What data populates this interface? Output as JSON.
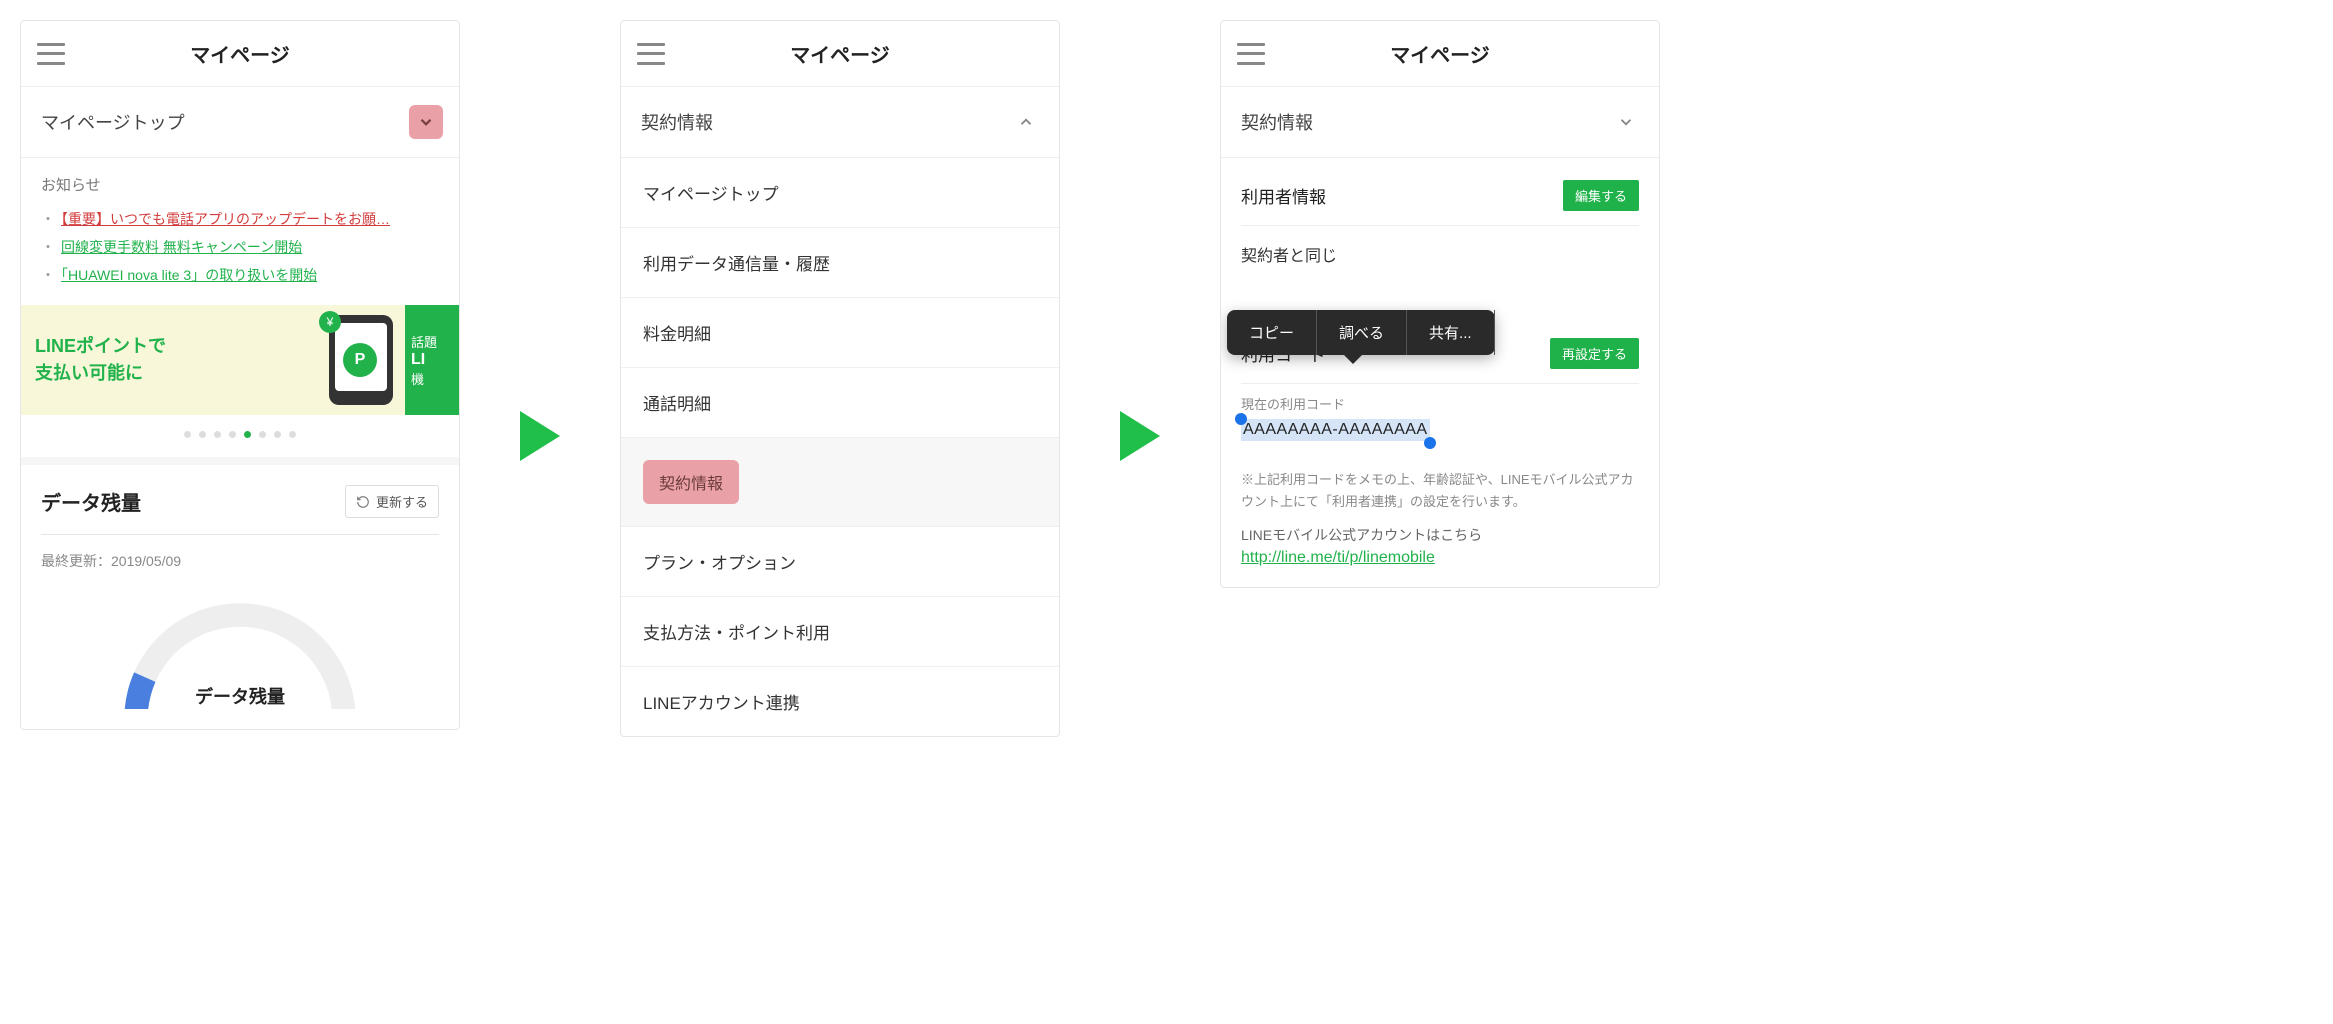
{
  "header": {
    "title": "マイページ"
  },
  "screen1": {
    "section_title": "マイページトップ",
    "notices_heading": "お知らせ",
    "notices": [
      {
        "text": "【重要】いつでも電話アプリのアップデートをお願…",
        "style": "red"
      },
      {
        "text": "回線変更手数料 無料キャンペーン開始",
        "style": "green"
      },
      {
        "text": "「HUAWEI nova lite 3」の取り扱いを開始",
        "style": "green"
      }
    ],
    "banner": {
      "line1": "LINEポイントで",
      "line2": "支払い可能に",
      "p_badge": "P",
      "yen_badge": "¥",
      "side1": "話題",
      "side2": "LI",
      "side3": "機"
    },
    "carousel": {
      "count": 8,
      "active": 4
    },
    "data_title": "データ残量",
    "refresh_label": "更新する",
    "updated_prefix": "最終更新：",
    "updated_date": "2019/05/09",
    "donut_label": "データ残量"
  },
  "screen2": {
    "section_title": "契約情報",
    "items": [
      "マイページトップ",
      "利用データ通信量・履歴",
      "料金明細",
      "通話明細",
      "契約情報",
      "プラン・オプション",
      "支払方法・ポイント利用",
      "LINEアカウント連携"
    ],
    "highlighted_index": 4
  },
  "screen3": {
    "section_title": "契約情報",
    "user_info_label": "利用者情報",
    "edit_label": "編集する",
    "same_as_contractor": "契約者と同じ",
    "usage_code_label": "利用コード",
    "reset_label": "再設定する",
    "current_code_label": "現在の利用コード",
    "code_value": "AAAAAAAA-AAAAAAAA",
    "note": "※上記利用コードをメモの上、年齢認証や、LINEモバイル公式アカウント上にて「利用者連携」の設定を行います。",
    "note2": "LINEモバイル公式アカウントはこちら",
    "link": "http://line.me/ti/p/linemobile",
    "context_menu": [
      "コピー",
      "調べる",
      "共有..."
    ]
  }
}
